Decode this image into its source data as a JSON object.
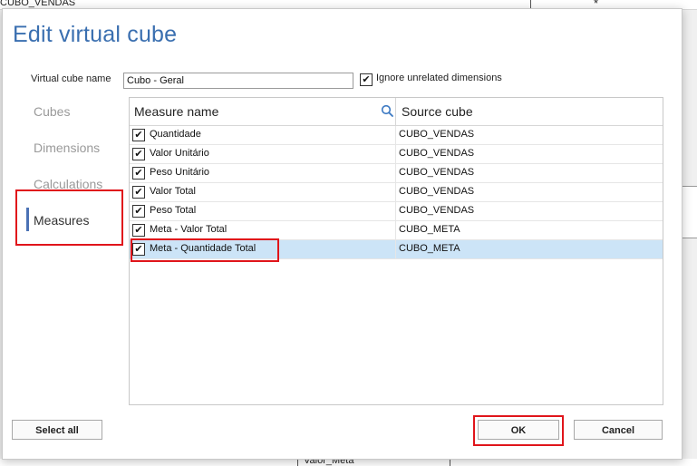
{
  "background": {
    "top_text": "CUBO_VENDAS",
    "bottom_text": "Valor_Meta",
    "top_right_symbol": "*"
  },
  "dialog": {
    "title": "Edit virtual cube",
    "name_label": "Virtual cube name",
    "name_value": "Cubo - Geral",
    "ignore_checked": true,
    "ignore_label": "Ignore unrelated dimensions"
  },
  "nav": {
    "items": [
      {
        "label": "Cubes",
        "active": false
      },
      {
        "label": "Dimensions",
        "active": false
      },
      {
        "label": "Calculations",
        "active": false
      },
      {
        "label": "Measures",
        "active": true
      }
    ]
  },
  "grid": {
    "headers": {
      "measure": "Measure name",
      "source": "Source cube"
    },
    "rows": [
      {
        "checked": true,
        "name": "Quantidade",
        "cube": "CUBO_VENDAS",
        "selected": false
      },
      {
        "checked": true,
        "name": "Valor Unitário",
        "cube": "CUBO_VENDAS",
        "selected": false
      },
      {
        "checked": true,
        "name": "Peso Unitário",
        "cube": "CUBO_VENDAS",
        "selected": false
      },
      {
        "checked": true,
        "name": "Valor Total",
        "cube": "CUBO_VENDAS",
        "selected": false
      },
      {
        "checked": true,
        "name": "Peso Total",
        "cube": "CUBO_VENDAS",
        "selected": false
      },
      {
        "checked": true,
        "name": "Meta - Valor Total",
        "cube": "CUBO_META",
        "selected": false
      },
      {
        "checked": true,
        "name": "Meta - Quantidade Total",
        "cube": "CUBO_META",
        "selected": true
      }
    ]
  },
  "buttons": {
    "select_all": "Select all",
    "ok": "OK",
    "cancel": "Cancel"
  },
  "colors": {
    "title": "#3a6fb0",
    "active_nav_bar": "#4b72b5",
    "selected_row": "#cce4f7",
    "highlight_box": "#e0151b"
  }
}
